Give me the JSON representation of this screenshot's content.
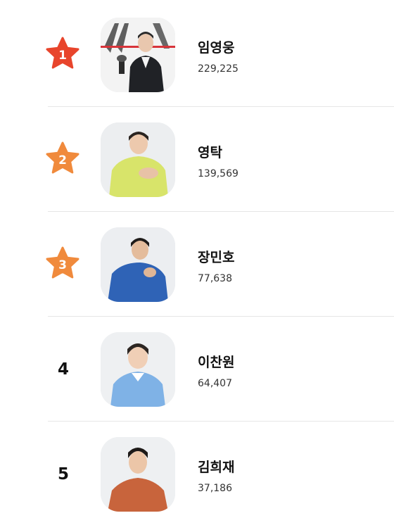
{
  "ranking": {
    "items": [
      {
        "rank": "1",
        "name": "임영웅",
        "count": "229,225",
        "badge_color": "#e8452c",
        "badge_color_dark": "#d33a22"
      },
      {
        "rank": "2",
        "name": "영탁",
        "count": "139,569",
        "badge_color": "#f08a3c",
        "badge_color_dark": "#e07a2c"
      },
      {
        "rank": "3",
        "name": "장민호",
        "count": "77,638",
        "badge_color": "#f08a3c",
        "badge_color_dark": "#e07a2c"
      },
      {
        "rank": "4",
        "name": "이찬원",
        "count": "64,407"
      },
      {
        "rank": "5",
        "name": "김희재",
        "count": "37,186"
      }
    ]
  }
}
